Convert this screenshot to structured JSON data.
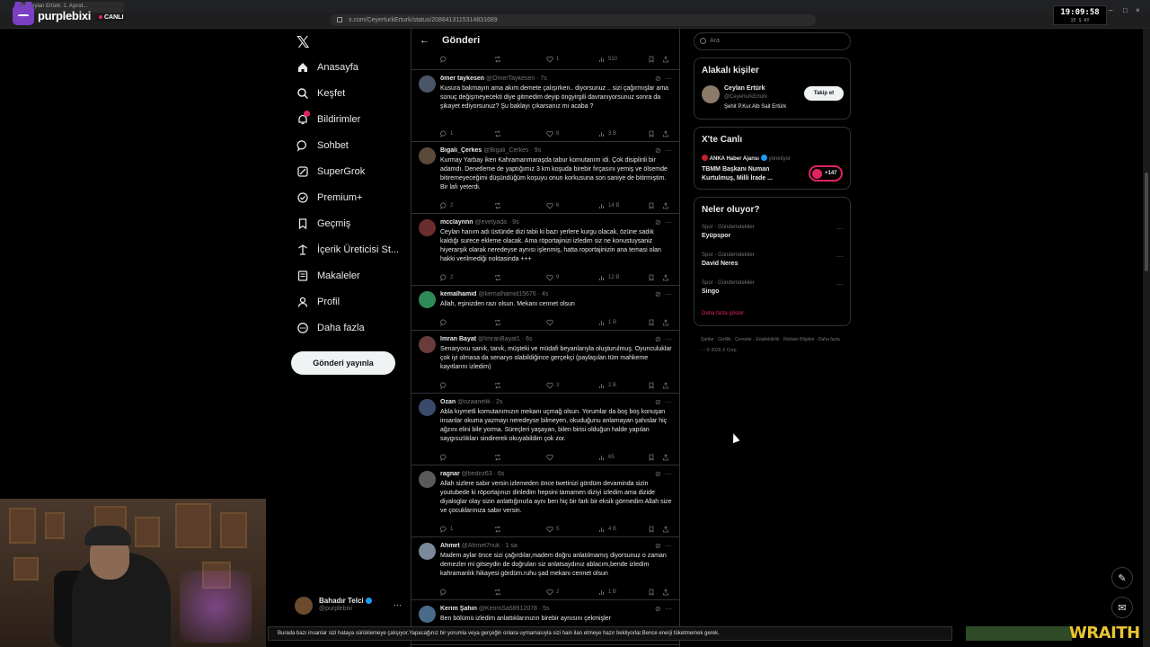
{
  "browser": {
    "tab_title": "fe Ceylan Ertürk: 1. Aşırıd...",
    "url": "x.com/CeyerturkErturk/status/2088413115314831689",
    "clock": "19:09:58",
    "clock_sub": "15 Ş AY"
  },
  "overlay": {
    "brand": "purplebixi",
    "live_label": "CANLI",
    "ticker": "Burada bazı insanlar sizi hataya sürüklemeye çalışıyor.Yapacağınız bir yorumla veya gerçeğin onlara uymamasıyla sizi hain ilan etmeye hazır bekliyorlar.Bence enerji tüketmemek gerek.",
    "sponsor": "WRAITH"
  },
  "nav": {
    "items": [
      {
        "label": "Anasayfa",
        "icon": "home-icon"
      },
      {
        "label": "Keşfet",
        "icon": "search-icon"
      },
      {
        "label": "Bildirimler",
        "icon": "bell-icon"
      },
      {
        "label": "Sohbet",
        "icon": "chat-icon"
      },
      {
        "label": "SuperGrok",
        "icon": "grok-icon"
      },
      {
        "label": "Premium+",
        "icon": "premium-icon"
      },
      {
        "label": "Geçmiş",
        "icon": "bookmark-icon"
      },
      {
        "label": "İçerik Üreticisi St...",
        "icon": "creator-icon"
      },
      {
        "label": "Makaleler",
        "icon": "article-icon"
      },
      {
        "label": "Profil",
        "icon": "person-icon"
      },
      {
        "label": "Daha fazla",
        "icon": "more-circle-icon"
      }
    ],
    "post_button": "Gönderi yayınla",
    "account": {
      "name": "Bahadır Telci",
      "handle": "@purplebixi",
      "more": "···"
    }
  },
  "center": {
    "title": "Gönderi",
    "top_stats": {
      "reply": "",
      "retweet": "",
      "like": "1",
      "views": "510"
    },
    "tweets": [
      {
        "name": "ömer taykesen",
        "handle": "@OmerTaykesen",
        "time": "7s",
        "text": "Kusura bakmayın ama akım demete çalışırken.. diyorsunuz .. sizi çağırmışlar ama sonuç değişmeyecekti diye gitmedim deyip öngyirgili davranıyorsunuz sonra da şikayet ediyorsunuz? Şu baklayı çıkarsanız mı acaba ?",
        "reply": "1",
        "retweet": "",
        "like": "8",
        "views": "3 B"
      },
      {
        "name": "Bigalı_Çerkes",
        "handle": "@Bigali_Cerkes",
        "time": "9s",
        "text": "Kurmay Yarbay iken Kahramanmaraşda tabur komutanım idi. Çok disiplinli bir adamdı. Denetleme de yaptığımız 3 km koşuda birebir fırçasını yemiş ve ölsemde bitiremeyeceğimi düşündüğüm koşuyu onun korkusuna son saniye de bitirmiştim. Bir lafı yeterdi.",
        "reply": "2",
        "retweet": "",
        "like": "6",
        "views": "14 B"
      },
      {
        "name": "mcclaynnn",
        "handle": "@evetyada",
        "time": "9s",
        "text": "Ceylan hanım adı üstünde dizi tabii ki bazı yerlere kurgu olacak, özüne sadık kaldığı surece ekleme olacak. Ama röportajinizi izledim siz ne konustuysaniz hiyerarşik olarak neredeyse aynısı işlenmiş, hatta roportajinizin ana temasi olan hakki verilmediği noktasinda +++",
        "reply": "2",
        "retweet": "",
        "like": "9",
        "views": "12 B"
      },
      {
        "name": "kemalhamid",
        "handle": "@kemalhamid15676",
        "time": "4s",
        "text": "Allah, eşinizden razı olsun.  Mekanı cennet olsun",
        "reply": "",
        "retweet": "",
        "like": "",
        "views": "1 B"
      },
      {
        "name": "İmran Bayat",
        "handle": "@ImranBayat1",
        "time": "6s",
        "text": "Senaryosu sanık, tanık, müşteki ve müdafi beyanlarıyla oluşturulmuş. Oyunculuklar çok iyi olmasa da senaryo olabildiğince gerçekçi (paylaşılan tüm mahkeme kayıtlarını izledim)",
        "reply": "",
        "retweet": "",
        "like": "3",
        "views": "2 B"
      },
      {
        "name": "Ozan",
        "handle": "@ozaanelik",
        "time": "2s",
        "text": "Abla kıymetli komutanımızın mekanı uçmağ olsun. Yorumlar da boş boş konuşan insanlar okuma yazmayı neredeyse bilmeyen, okuduğunu anlamayan şahıslar hiç ağzını elini bile yorma. Süreçleri yaşayan, bilen birisi olduğun halde yapılan saygısızlıkları sindirerek okuyabildim çok zor.",
        "reply": "",
        "retweet": "",
        "like": "",
        "views": "65"
      },
      {
        "name": "ragnar",
        "handle": "@bedirz63",
        "time": "6s",
        "text": "Allah sizlere sabır versin  izlemeden önce twetinizi gördüm devaminda sizin youtubede ki röportajınızı dinledim hepsini tamamen diziyi izledim ama dizide  diyaloglar olay sizin anlattığınızla aynı ben hiç bir fark bir eksik görmedim Allah size ve çocuklarınıza sabır versin.",
        "reply": "1",
        "retweet": "",
        "like": "5",
        "views": "4 B"
      },
      {
        "name": "Ahmet",
        "handle": "@Ahmet7nuk",
        "time": "1 sa",
        "text": "Madem aylar önce sizi çağırdılar,madem doğru anlatılmamış diyorsunuz o zaman demezler mi gitseydin de doğruları siz anlatsaydınız ablacım,bende izledim kahramanlık hikayesi gördüm.ruhu şad mekanı cennet olsun",
        "reply": "",
        "retweet": "",
        "like": "2",
        "views": "1 B"
      },
      {
        "name": "Kerim Şahin",
        "handle": "@KerimSa58912078",
        "time": "5s",
        "text": "Ben bölümü izledim anlattıklarınızın birebir aynısını çekmişler",
        "reply": "",
        "retweet": "",
        "like": "2",
        "views": "946"
      }
    ]
  },
  "right": {
    "search_placeholder": "Ara",
    "related_title": "Alakalı kişiler",
    "related_person": {
      "name": "Ceylan Ertürk",
      "handle": "@CeyerturkErturk",
      "bio": "Şehit P.Kur.Alb Sait Ertürk",
      "follow": "Takip et"
    },
    "live_title": "X'te Canlı",
    "live_host": "ANKA Haber Ajansı",
    "live_host_suffix": "yönetiyor",
    "live_text_1": "TBMM Başkanı Numan",
    "live_text_2": "Kurtulmuş, Milli İrade ...",
    "live_count": "+147",
    "trends_title": "Neler oluyor?",
    "trends": [
      {
        "category": "Spor · Gündemdekiler",
        "name": "Eyüpspor"
      },
      {
        "category": "Spor · Gündemdekiler",
        "name": "David Neres"
      },
      {
        "category": "Spor · Gündemdekiler",
        "name": "Singo"
      }
    ],
    "show_more": "Daha fazla göster",
    "footer": "Şartlar · Gizlilik · Çerezler · Erişilebilirlik · Reklam Bilgileri · Daha fazla ··· © 2026 X Corp."
  }
}
